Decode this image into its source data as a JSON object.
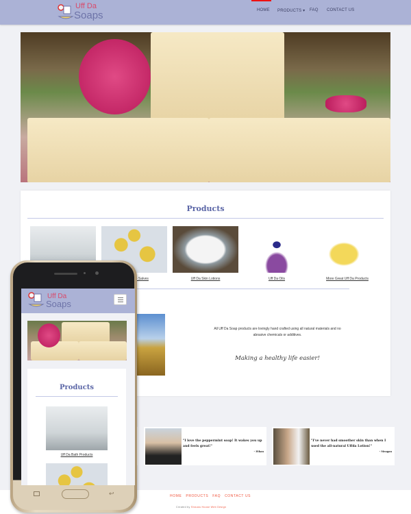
{
  "header": {
    "logo_top": "Uff Da",
    "logo_bottom": "Soaps",
    "nav": [
      {
        "label": "HOME"
      },
      {
        "label": "PRODUCTS ▾"
      },
      {
        "label": "FAQ"
      },
      {
        "label": "CONTACT US"
      }
    ]
  },
  "products": {
    "title": "Products",
    "items": [
      {
        "label": "Uff Da Bath Products"
      },
      {
        "label": "Uff Da Pine Salves"
      },
      {
        "label": "Uff Da Skin Lotions"
      },
      {
        "label": "Uff Da Oils"
      },
      {
        "label": "More Great Uff Da Products"
      }
    ]
  },
  "about": {
    "text": "All Uff Da Soap products are lovingly hand crafted using all natural materials and no abrasive chemicals or additives.",
    "tagline": "Making a healthy life easier!"
  },
  "testimonials": [
    {
      "quote": "\"I love the peppermint soap! It wakes you up and feels great!\"",
      "author": "- Ethan"
    },
    {
      "quote": "\"I've never had smoother skin than when I used the all-natural Uffda Lotion!\"",
      "author": "- Meagan"
    }
  ],
  "footer": {
    "links": [
      {
        "label": "HOME"
      },
      {
        "label": "PRODUCTS"
      },
      {
        "label": "FAQ"
      },
      {
        "label": "CONTACT US"
      }
    ],
    "credit_prefix": "Created by",
    "credit_link": "Strauss House Web Design"
  },
  "colors": {
    "header": "#abb2d6",
    "accent": "#5a65a6",
    "footer_link": "#f0543c"
  }
}
